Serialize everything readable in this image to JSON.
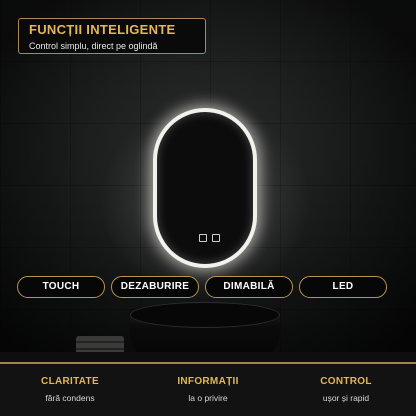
{
  "header": {
    "title": "FUNCȚII INTELIGENTE",
    "subtitle": "Control simplu, direct pe oglindă"
  },
  "features": [
    "TOUCH",
    "DEZABURIRE",
    "DIMABILĂ",
    "LED"
  ],
  "benefits": [
    {
      "title": "CLARITATE",
      "desc": "fără condens"
    },
    {
      "title": "INFORMAȚII",
      "desc": "la o privire"
    },
    {
      "title": "CONTROL",
      "desc": "ușor și rapid"
    }
  ],
  "colors": {
    "accent": "#e3b659",
    "border": "#b89354",
    "background": "#101112"
  },
  "icons": [
    "touch-sensor-icon"
  ]
}
